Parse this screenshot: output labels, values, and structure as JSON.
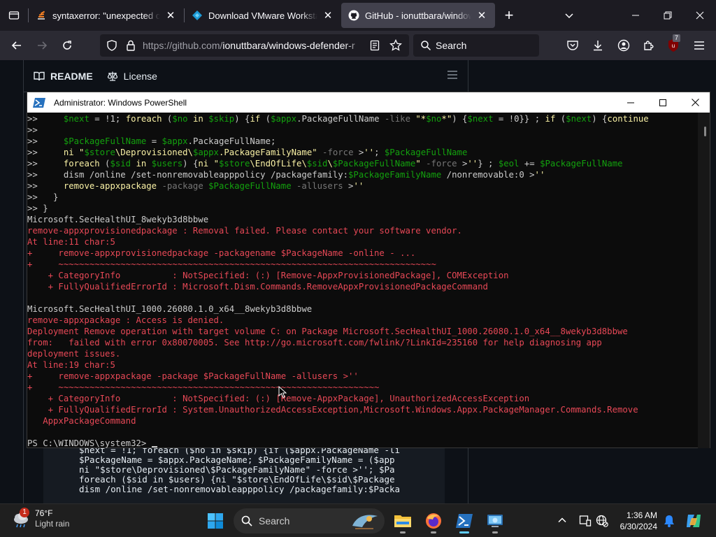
{
  "browser": {
    "tabs": [
      {
        "title": "syntaxerror: \"unexpected chara",
        "active": false
      },
      {
        "title": "Download VMware Workstation",
        "active": false
      },
      {
        "title": "GitHub - ionuttbara/windows-d",
        "active": true
      }
    ],
    "url_host": "https://github.com/",
    "url_path": "ionuttbara/windows-defender-r",
    "search_placeholder": "Search",
    "extension_badge": "7"
  },
  "github": {
    "tabs": [
      {
        "label": "README"
      },
      {
        "label": "License"
      }
    ],
    "code_lines": [
      "$next = !1; foreach ($no in $skip) {if ($appx.PackageName -li",
      "$PackageName = $appx.PackageName; $PackageFamilyName = ($app",
      "ni \"$store\\Deprovisioned\\$PackageFamilyName\" -force >''; $Pa",
      "foreach ($sid in $users) {ni \"$store\\EndOfLife\\$sid\\$Package",
      "dism /online /set-nonremovableapppolicy /packagefamily:$Packa"
    ]
  },
  "powershell": {
    "title": "Administrator: Windows PowerShell",
    "lines": [
      [
        {
          "t": ">>     ",
          "c": "w"
        },
        {
          "t": "$next",
          "c": "g"
        },
        {
          "t": " = ",
          "c": "w"
        },
        {
          "t": "!1",
          "c": "w"
        },
        {
          "t": "; ",
          "c": "w"
        },
        {
          "t": "foreach",
          "c": "y"
        },
        {
          "t": " (",
          "c": "w"
        },
        {
          "t": "$no",
          "c": "g"
        },
        {
          "t": " in ",
          "c": "y"
        },
        {
          "t": "$skip",
          "c": "g"
        },
        {
          "t": ") {",
          "c": "w"
        },
        {
          "t": "if",
          "c": "y"
        },
        {
          "t": " (",
          "c": "w"
        },
        {
          "t": "$appx",
          "c": "g"
        },
        {
          "t": ".PackageFullName ",
          "c": "w"
        },
        {
          "t": "-like",
          "c": "gr"
        },
        {
          "t": " \"*",
          "c": "y"
        },
        {
          "t": "$no",
          "c": "g"
        },
        {
          "t": "*\"",
          "c": "y"
        },
        {
          "t": ") {",
          "c": "w"
        },
        {
          "t": "$next",
          "c": "g"
        },
        {
          "t": " = ",
          "c": "w"
        },
        {
          "t": "!0",
          "c": "w"
        },
        {
          "t": "}} ; ",
          "c": "w"
        },
        {
          "t": "if",
          "c": "y"
        },
        {
          "t": " (",
          "c": "w"
        },
        {
          "t": "$next",
          "c": "g"
        },
        {
          "t": ") {",
          "c": "w"
        },
        {
          "t": "continue",
          "c": "y"
        }
      ],
      [
        {
          "t": ">>",
          "c": "w"
        }
      ],
      [
        {
          "t": ">>     ",
          "c": "w"
        },
        {
          "t": "$PackageFullName",
          "c": "g"
        },
        {
          "t": " = ",
          "c": "w"
        },
        {
          "t": "$appx",
          "c": "g"
        },
        {
          "t": ".PackageFullName;",
          "c": "w"
        }
      ],
      [
        {
          "t": ">>     ",
          "c": "w"
        },
        {
          "t": "ni",
          "c": "y"
        },
        {
          "t": " \"",
          "c": "y"
        },
        {
          "t": "$store",
          "c": "g"
        },
        {
          "t": "\\Deprovisioned\\",
          "c": "y"
        },
        {
          "t": "$appx",
          "c": "g"
        },
        {
          "t": ".PackageFamilyName",
          "c": "y"
        },
        {
          "t": "\" ",
          "c": "y"
        },
        {
          "t": "-force",
          "c": "gr"
        },
        {
          "t": " >",
          "c": "w"
        },
        {
          "t": "''",
          "c": "y"
        },
        {
          "t": "; ",
          "c": "w"
        },
        {
          "t": "$PackageFullName",
          "c": "g"
        }
      ],
      [
        {
          "t": ">>     ",
          "c": "w"
        },
        {
          "t": "foreach",
          "c": "y"
        },
        {
          "t": " (",
          "c": "w"
        },
        {
          "t": "$sid",
          "c": "g"
        },
        {
          "t": " in ",
          "c": "y"
        },
        {
          "t": "$users",
          "c": "g"
        },
        {
          "t": ") {",
          "c": "w"
        },
        {
          "t": "ni",
          "c": "y"
        },
        {
          "t": " \"",
          "c": "y"
        },
        {
          "t": "$store",
          "c": "g"
        },
        {
          "t": "\\EndOfLife\\",
          "c": "y"
        },
        {
          "t": "$sid",
          "c": "g"
        },
        {
          "t": "\\",
          "c": "y"
        },
        {
          "t": "$PackageFullName",
          "c": "g"
        },
        {
          "t": "\" ",
          "c": "y"
        },
        {
          "t": "-force",
          "c": "gr"
        },
        {
          "t": " >",
          "c": "w"
        },
        {
          "t": "''",
          "c": "y"
        },
        {
          "t": "} ; ",
          "c": "w"
        },
        {
          "t": "$eol",
          "c": "g"
        },
        {
          "t": " += ",
          "c": "w"
        },
        {
          "t": "$PackageFullName",
          "c": "g"
        }
      ],
      [
        {
          "t": ">>     ",
          "c": "w"
        },
        {
          "t": "dism /online /set-nonremovableapppolicy /packagefamily:",
          "c": "w"
        },
        {
          "t": "$PackageFamilyName",
          "c": "g"
        },
        {
          "t": " /nonremovable:0 >",
          "c": "w"
        },
        {
          "t": "''",
          "c": "y"
        }
      ],
      [
        {
          "t": ">>     ",
          "c": "w"
        },
        {
          "t": "remove-appxpackage",
          "c": "y"
        },
        {
          "t": " -package ",
          "c": "gr"
        },
        {
          "t": "$PackageFullName",
          "c": "g"
        },
        {
          "t": " -allusers",
          "c": "gr"
        },
        {
          "t": " >",
          "c": "w"
        },
        {
          "t": "''",
          "c": "y"
        }
      ],
      [
        {
          "t": ">>   }",
          "c": "w"
        }
      ],
      [
        {
          "t": ">> }",
          "c": "w"
        }
      ],
      [
        {
          "t": "Microsoft.SecHealthUI_8wekyb3d8bbwe",
          "c": "w"
        }
      ],
      [
        {
          "t": "remove-appxprovisionedpackage : Removal failed. Please contact your software vendor.",
          "c": "r"
        }
      ],
      [
        {
          "t": "At line:11 char:5",
          "c": "r"
        }
      ],
      [
        {
          "t": "+     remove-appxprovisionedpackage -packagename $PackageName -online - ...",
          "c": "r"
        }
      ],
      [
        {
          "t": "+     ~~~~~~~~~~~~~~~~~~~~~~~~~~~~~~~~~~~~~~~~~~~~~~~~~~~~~~~~~~~~~~~~~~~~~~~~~",
          "c": "r"
        }
      ],
      [
        {
          "t": "    + CategoryInfo          : NotSpecified: (:) [Remove-AppxProvisionedPackage], COMException",
          "c": "r"
        }
      ],
      [
        {
          "t": "    + FullyQualifiedErrorId : Microsoft.Dism.Commands.RemoveAppxProvisionedPackageCommand",
          "c": "r"
        }
      ],
      [
        {
          "t": "",
          "c": "w"
        }
      ],
      [
        {
          "t": "Microsoft.SecHealthUI_1000.26080.1.0_x64__8wekyb3d8bbwe",
          "c": "w"
        }
      ],
      [
        {
          "t": "remove-appxpackage : Access is denied.",
          "c": "r"
        }
      ],
      [
        {
          "t": "Deployment Remove operation with target volume C: on Package Microsoft.SecHealthUI_1000.26080.1.0_x64__8wekyb3d8bbwe",
          "c": "r"
        }
      ],
      [
        {
          "t": "from:   failed with error 0x80070005. See http://go.microsoft.com/fwlink/?LinkId=235160 for help diagnosing app",
          "c": "r"
        }
      ],
      [
        {
          "t": "deployment issues.",
          "c": "r"
        }
      ],
      [
        {
          "t": "At line:19 char:5",
          "c": "r"
        }
      ],
      [
        {
          "t": "+     remove-appxpackage -package $PackageFullName -allusers >''",
          "c": "r"
        }
      ],
      [
        {
          "t": "+     ~~~~~~~~~~~~~~~~~~~~~~~~~~~~~~~~~~~~~~~~~~~~~~~~~~~~~~~~~~~~~~",
          "c": "r"
        }
      ],
      [
        {
          "t": "    + CategoryInfo          : NotSpecified: (:) [Remove-AppxPackage], UnauthorizedAccessException",
          "c": "r"
        }
      ],
      [
        {
          "t": "    + FullyQualifiedErrorId : System.UnauthorizedAccessException,Microsoft.Windows.Appx.PackageManager.Commands.Remove",
          "c": "r"
        }
      ],
      [
        {
          "t": "   AppxPackageCommand",
          "c": "r"
        }
      ],
      [
        {
          "t": "",
          "c": "w"
        }
      ],
      [
        {
          "t": "PS C:\\WINDOWS\\system32> ",
          "c": "w"
        }
      ]
    ]
  },
  "taskbar": {
    "weather_temp": "76°F",
    "weather_desc": "Light rain",
    "weather_badge": "1",
    "search_placeholder": "Search",
    "time": "1:36 AM",
    "date": "6/30/2024"
  },
  "colors": {
    "ps_background": "#0c0c0c",
    "ps_error": "#e74856",
    "ps_string": "#f9f1a5",
    "ps_variable": "#13a10e",
    "accent": "#60cdff"
  }
}
